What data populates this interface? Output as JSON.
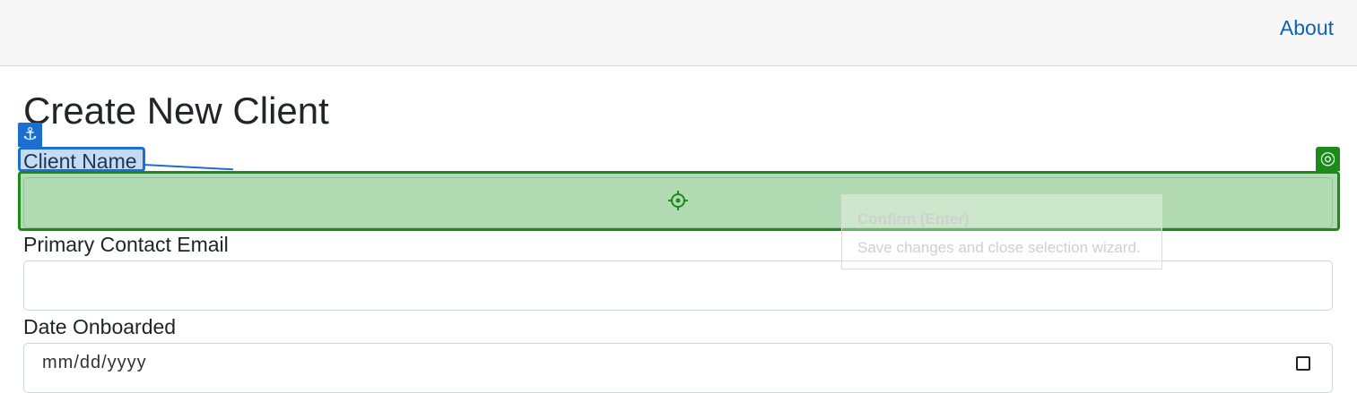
{
  "nav": {
    "about_label": "About"
  },
  "page": {
    "title": "Create New Client"
  },
  "form": {
    "client_name_label": "Client Name",
    "client_name_value": "",
    "email_label": "Primary Contact Email",
    "email_value": "",
    "date_label": "Date Onboarded",
    "date_placeholder": "mm/dd/yyyy"
  },
  "wizard": {
    "anchor_icon": "anchor-icon",
    "target_icon": "target-icon",
    "crosshair_icon": "crosshair-icon",
    "tooltip_title": "Confirm (Enter)",
    "tooltip_desc": "Save changes and close selection wizard.",
    "anchor_color": "#1a6fd0",
    "target_color": "#1b8a1b"
  },
  "theme": {
    "link_color": "#0b63b6",
    "navbar_bg": "#f7f7f7"
  }
}
